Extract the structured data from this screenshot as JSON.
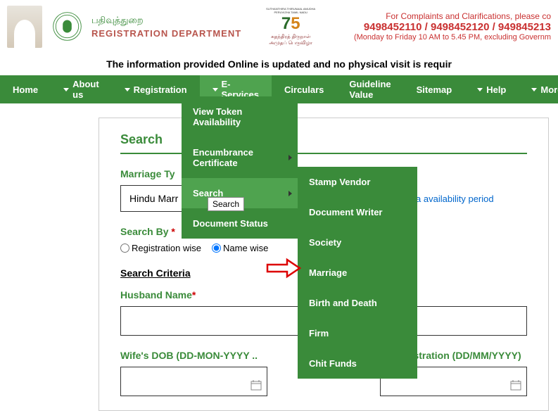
{
  "header": {
    "dept_tamil": "பதிவுத்துறை",
    "dept_eng": "REGISTRATION DEPARTMENT",
    "emblem75_top": "SUTHANTHIRA THIRUNAAL AMUDHA PERUVIZHA TAMIL NADU",
    "emblem75_7": "7",
    "emblem75_5": "5",
    "emblem75_bot": "சுதந்திரத் திருநாள் அமுதப் பெருவிழா",
    "complaints_line1": "For Complaints and Clarifications, please co",
    "complaints_line2": "9498452110 / 9498452120 / 949845213",
    "complaints_line3": "(Monday to Friday 10 AM to 5.45 PM, excluding Governm"
  },
  "info_bar": "The information provided Online is updated and no physical visit is requir",
  "nav": {
    "home": "Home",
    "about": "About us",
    "registration": "Registration",
    "eservices": "E-Services",
    "circulars": "Circulars",
    "guideline": "Guideline Value",
    "sitemap": "Sitemap",
    "help": "Help",
    "more": "More"
  },
  "dropdown1": {
    "token": "View Token Availability",
    "ec": "Encumbrance Certificate",
    "search": "Search",
    "docstatus": "Document Status"
  },
  "tooltip": "Search",
  "dropdown2": {
    "stamp": "Stamp Vendor",
    "docwriter": "Document Writer",
    "society": "Society",
    "marriage": "Marriage",
    "birth": "Birth and Death",
    "firm": "Firm",
    "chit": "Chit Funds"
  },
  "form": {
    "title": "Search",
    "marriage_type_label": "Marriage Ty",
    "marriage_type_value": "Hindu Marr",
    "availability_link": "know data availability period",
    "search_by_label": "Search By ",
    "radio1": "Registration wise",
    "radio2": "Name wise",
    "criteria": "Search Criteria",
    "husband_label": "Husband Name",
    "wife_dob_label": "Wife's DOB (DD-MON-YYYY ..",
    "reg_date_label": "of Registration (DD/MM/YYYY)"
  }
}
